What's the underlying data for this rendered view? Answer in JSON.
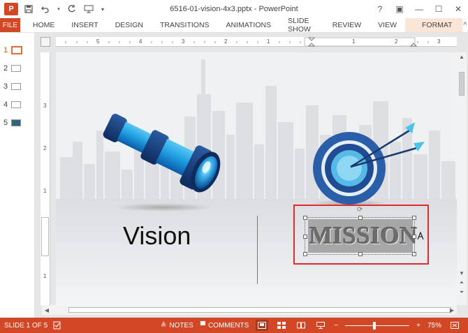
{
  "app": {
    "logo_letter": "P",
    "title": "6516-01-vision-4x3.pptx - PowerPoint"
  },
  "window": {
    "help": "?",
    "ribbon_display": "▣",
    "minimize": "—",
    "maximize": "☐",
    "close": "✕"
  },
  "tabs": {
    "file": "FILE",
    "items": [
      "HOME",
      "INSERT",
      "DESIGN",
      "TRANSITIONS",
      "ANIMATIONS",
      "SLIDE SHOW",
      "REVIEW",
      "VIEW"
    ],
    "format": "FORMAT",
    "collapse": "^"
  },
  "thumbnails": [
    {
      "num": "1",
      "active": true
    },
    {
      "num": "2",
      "active": false
    },
    {
      "num": "3",
      "active": false
    },
    {
      "num": "4",
      "active": false
    },
    {
      "num": "5",
      "active": false
    }
  ],
  "ruler": {
    "h_numbers": [
      "5",
      "4",
      "3",
      "2",
      "1",
      "1",
      "2",
      "3"
    ],
    "v_numbers": [
      "3",
      "2",
      "1",
      "1"
    ]
  },
  "slide": {
    "vision_label": "Vision",
    "mission_label": "MISSION"
  },
  "status": {
    "slide_counter": "SLIDE 1 OF 5",
    "notes": "NOTES",
    "comments": "COMMENTS",
    "zoom_out": "−",
    "zoom_in": "+",
    "zoom_level": "75%"
  },
  "colors": {
    "accent": "#d24726",
    "selection": "#e12b2b",
    "telescope_dark": "#1a3f77",
    "telescope_light": "#1e9be0",
    "target_ring": "#2a5ea8"
  }
}
